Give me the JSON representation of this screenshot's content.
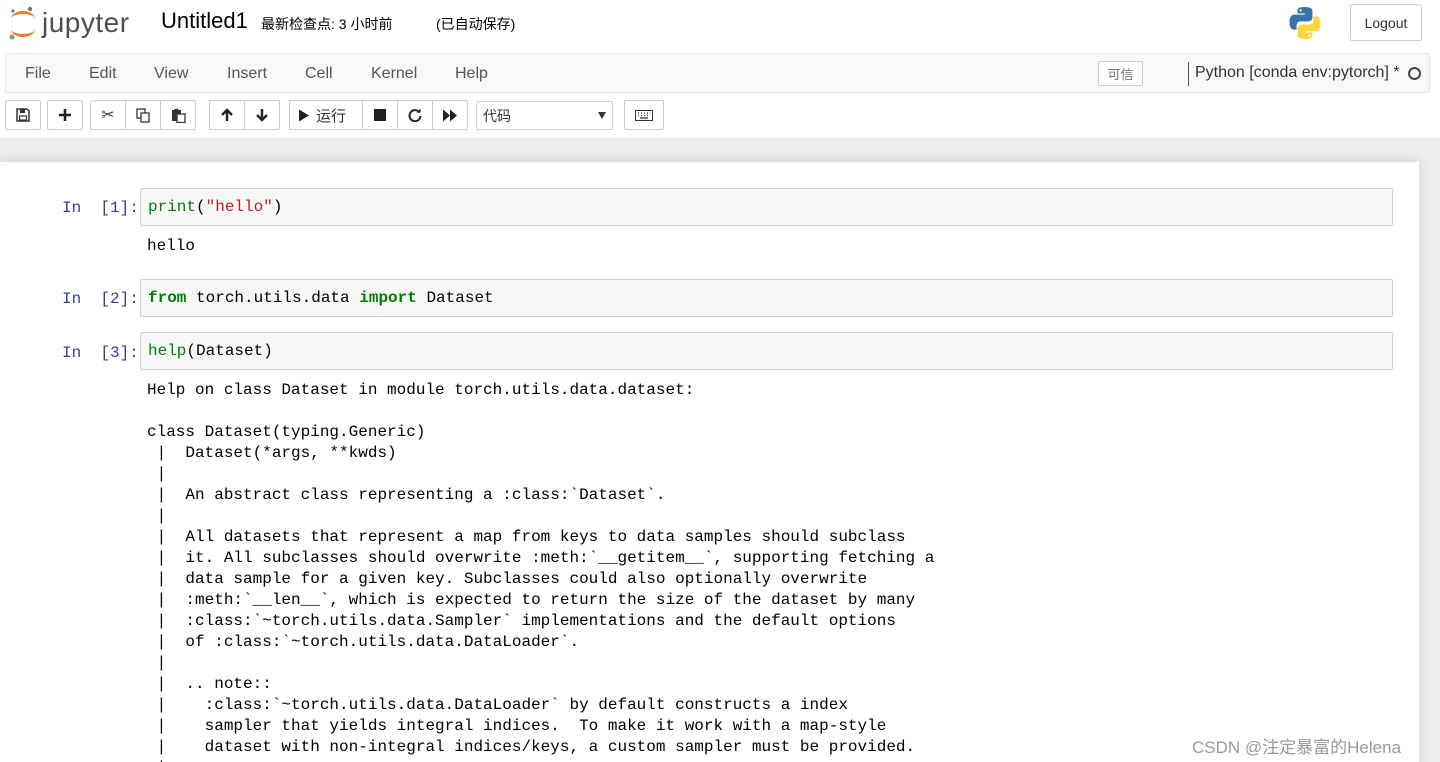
{
  "header": {
    "logo_text": "jupyter",
    "notebook_name": "Untitled1",
    "checkpoint": "最新检查点: 3 小时前",
    "autosave": "(已自动保存)",
    "logout": "Logout"
  },
  "menubar": {
    "items": [
      "File",
      "Edit",
      "View",
      "Insert",
      "Cell",
      "Kernel",
      "Help"
    ],
    "trusted": "可信",
    "kernel_name": "Python [conda env:pytorch] *"
  },
  "toolbar": {
    "run_label": "运行",
    "cell_type": "代码"
  },
  "cells": [
    {
      "prompt": "In  [1]:",
      "code": [
        "print",
        "(",
        "\"hello\"",
        ")"
      ],
      "output": "hello"
    },
    {
      "prompt": "In  [2]:",
      "code": [
        "from",
        " torch.utils.data ",
        "import",
        " Dataset"
      ]
    },
    {
      "prompt": "In  [3]:",
      "code": [
        "help",
        "(Dataset)"
      ],
      "output": "Help on class Dataset in module torch.utils.data.dataset:\n\nclass Dataset(typing.Generic)\n |  Dataset(*args, **kwds)\n |  \n |  An abstract class representing a :class:`Dataset`.\n |  \n |  All datasets that represent a map from keys to data samples should subclass\n |  it. All subclasses should overwrite :meth:`__getitem__`, supporting fetching a\n |  data sample for a given key. Subclasses could also optionally overwrite\n |  :meth:`__len__`, which is expected to return the size of the dataset by many\n |  :class:`~torch.utils.data.Sampler` implementations and the default options\n |  of :class:`~torch.utils.data.DataLoader`.\n |  \n |  .. note::\n |    :class:`~torch.utils.data.DataLoader` by default constructs a index\n |    sampler that yields integral indices.  To make it work with a map-style\n |    dataset with non-integral indices/keys, a custom sampler must be provided.\n |"
    }
  ],
  "watermark": "CSDN @注定暴富的Helena"
}
